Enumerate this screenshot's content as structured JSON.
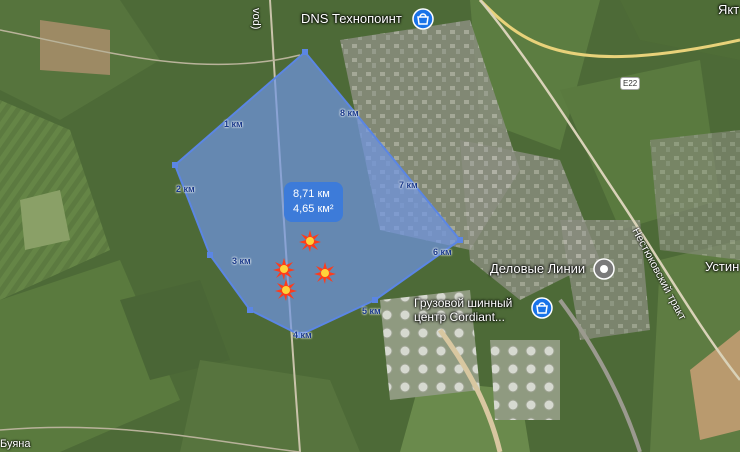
{
  "map": {
    "places": {
      "dns": "DNS Технопоинт",
      "delovye": "Деловые Линии",
      "cordiant_line1": "Грузовой шинный",
      "cordiant_line2": "центр Cordiant...",
      "ust": "Устин",
      "yak": "Якт",
      "nestyukovsky": "Нестюковский тракт",
      "top_road": "vod)",
      "bottom_left": "Буяна"
    },
    "route_badge": "E22",
    "measurement": {
      "distance": "8,71 км",
      "area": "4,65 км²",
      "ticks": [
        "1 км",
        "2 км",
        "3 км",
        "4 км",
        "5 км",
        "6 км",
        "7 км",
        "8 км"
      ]
    },
    "colors": {
      "polygon_fill": "#6f96e6",
      "polygon_stroke": "#5b86e4",
      "badge": "#3d7bd9",
      "explosion": "#ff3b1a"
    },
    "markers": [
      "explosion-icon",
      "explosion-icon",
      "explosion-icon",
      "explosion-icon"
    ]
  }
}
